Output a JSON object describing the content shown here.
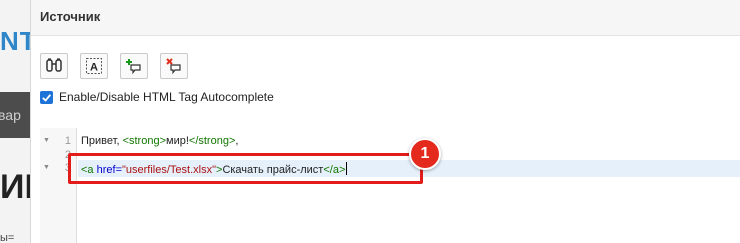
{
  "background": {
    "logo_fragment": "NT",
    "bar_text": "вар",
    "big_text": "ИК",
    "footer_text": "ы="
  },
  "dialog": {
    "title": "Источник"
  },
  "toolbar": {
    "buttons": [
      {
        "name": "find-icon"
      },
      {
        "name": "format-text-icon"
      },
      {
        "name": "add-comment-icon"
      },
      {
        "name": "remove-comment-icon"
      }
    ]
  },
  "autocomplete": {
    "label": "Enable/Disable HTML Tag Autocomplete",
    "checked": true
  },
  "editor": {
    "lines": [
      {
        "number": "1",
        "text_before": "Привет, ",
        "open_tag": "<strong>",
        "inner": "мир!",
        "close_tag": "</strong>",
        "trailing": ","
      },
      {
        "number": "2"
      },
      {
        "number": "3",
        "tag_open": "<a ",
        "attr_name": "href=",
        "attr_value": "\"userfiles/Test.xlsx\"",
        "tag_end": ">",
        "link_text": "Скачать прайс-лист",
        "close_tag": "</a>"
      }
    ]
  },
  "annotation": {
    "badge_label": "1",
    "color": "#e21b1b"
  }
}
